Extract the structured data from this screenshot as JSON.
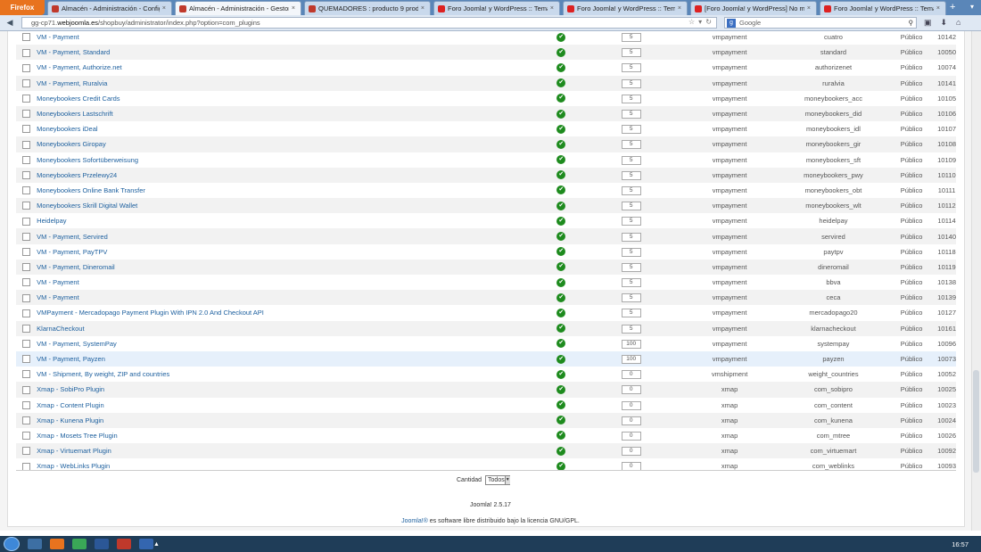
{
  "browser": {
    "app_button": "Firefox",
    "tabs": [
      {
        "label": "Almacén - Administración - Config...",
        "icon": "joomla-icon",
        "active": false
      },
      {
        "label": "Almacén - Administración - Gestor...",
        "icon": "joomla-icon",
        "active": true
      },
      {
        "label": "QUEMADORES : producto 9 produc...",
        "icon": "joomla-icon",
        "active": false
      },
      {
        "label": "Foro Joomla! y WordPress :: Tema:...",
        "icon": "wordpress-icon",
        "active": false
      },
      {
        "label": "Foro Joomla! y WordPress :: Tema:...",
        "icon": "wordpress-icon",
        "active": false
      },
      {
        "label": "[Foro Joomla! y WordPress] No me ...",
        "icon": "gmail-icon",
        "active": false
      },
      {
        "label": "Foro Joomla! y WordPress :: Tema:...",
        "icon": "wordpress-icon",
        "active": false
      }
    ],
    "url_prefix": "gg-cp71.",
    "url_domain": "webjoomla.es",
    "url_path": "/shopbuy/administrator/index.php?option=com_plugins",
    "search_placeholder": "Google"
  },
  "plugins": {
    "rows": [
      {
        "name": "VM - Payment",
        "order": "5",
        "folder": "vmpayment",
        "element": "cuatro",
        "access": "Público",
        "id": "10142"
      },
      {
        "name": "VM - Payment, Standard",
        "order": "5",
        "folder": "vmpayment",
        "element": "standard",
        "access": "Público",
        "id": "10050"
      },
      {
        "name": "VM - Payment, Authorize.net",
        "order": "5",
        "folder": "vmpayment",
        "element": "authorizenet",
        "access": "Público",
        "id": "10074"
      },
      {
        "name": "VM - Payment, Ruralvia",
        "order": "5",
        "folder": "vmpayment",
        "element": "ruralvia",
        "access": "Público",
        "id": "10141"
      },
      {
        "name": "Moneybookers Credit Cards",
        "order": "5",
        "folder": "vmpayment",
        "element": "moneybookers_acc",
        "access": "Público",
        "id": "10105"
      },
      {
        "name": "Moneybookers Lastschrift",
        "order": "5",
        "folder": "vmpayment",
        "element": "moneybookers_did",
        "access": "Público",
        "id": "10106"
      },
      {
        "name": "Moneybookers iDeal",
        "order": "5",
        "folder": "vmpayment",
        "element": "moneybookers_idl",
        "access": "Público",
        "id": "10107"
      },
      {
        "name": "Moneybookers Giropay",
        "order": "5",
        "folder": "vmpayment",
        "element": "moneybookers_gir",
        "access": "Público",
        "id": "10108"
      },
      {
        "name": "Moneybookers Sofortüberweisung",
        "order": "5",
        "folder": "vmpayment",
        "element": "moneybookers_sft",
        "access": "Público",
        "id": "10109"
      },
      {
        "name": "Moneybookers Przelewy24",
        "order": "5",
        "folder": "vmpayment",
        "element": "moneybookers_pwy",
        "access": "Público",
        "id": "10110"
      },
      {
        "name": "Moneybookers Online Bank Transfer",
        "order": "5",
        "folder": "vmpayment",
        "element": "moneybookers_obt",
        "access": "Público",
        "id": "10111"
      },
      {
        "name": "Moneybookers Skrill Digital Wallet",
        "order": "5",
        "folder": "vmpayment",
        "element": "moneybookers_wlt",
        "access": "Público",
        "id": "10112"
      },
      {
        "name": "Heidelpay",
        "order": "5",
        "folder": "vmpayment",
        "element": "heidelpay",
        "access": "Público",
        "id": "10114"
      },
      {
        "name": "VM - Payment, Servired",
        "order": "5",
        "folder": "vmpayment",
        "element": "servired",
        "access": "Público",
        "id": "10140"
      },
      {
        "name": "VM - Payment, PayTPV",
        "order": "5",
        "folder": "vmpayment",
        "element": "paytpv",
        "access": "Público",
        "id": "10118"
      },
      {
        "name": "VM - Payment, Dineromail",
        "order": "5",
        "folder": "vmpayment",
        "element": "dineromail",
        "access": "Público",
        "id": "10119"
      },
      {
        "name": "VM - Payment",
        "order": "5",
        "folder": "vmpayment",
        "element": "bbva",
        "access": "Público",
        "id": "10138"
      },
      {
        "name": "VM - Payment",
        "order": "5",
        "folder": "vmpayment",
        "element": "ceca",
        "access": "Público",
        "id": "10139"
      },
      {
        "name": "VMPayment - Mercadopago Payment Plugin With IPN 2.0 And Checkout API",
        "order": "5",
        "folder": "vmpayment",
        "element": "mercadopago20",
        "access": "Público",
        "id": "10127"
      },
      {
        "name": "KlarnaCheckout",
        "order": "5",
        "folder": "vmpayment",
        "element": "klarnacheckout",
        "access": "Público",
        "id": "10161"
      },
      {
        "name": "VM - Payment, SystemPay",
        "order": "100",
        "folder": "vmpayment",
        "element": "systempay",
        "access": "Público",
        "id": "10096"
      },
      {
        "name": "VM - Payment, Payzen",
        "order": "100",
        "folder": "vmpayment",
        "element": "payzen",
        "access": "Público",
        "id": "10073"
      },
      {
        "name": "VM - Shipment, By weight, ZIP and countries",
        "order": "0",
        "folder": "vmshipment",
        "element": "weight_countries",
        "access": "Público",
        "id": "10052"
      },
      {
        "name": "Xmap - SobiPro Plugin",
        "order": "0",
        "folder": "xmap",
        "element": "com_sobipro",
        "access": "Público",
        "id": "10025"
      },
      {
        "name": "Xmap - Content Plugin",
        "order": "0",
        "folder": "xmap",
        "element": "com_content",
        "access": "Público",
        "id": "10023"
      },
      {
        "name": "Xmap - Kunena Plugin",
        "order": "0",
        "folder": "xmap",
        "element": "com_kunena",
        "access": "Público",
        "id": "10024"
      },
      {
        "name": "Xmap - Mosets Tree Plugin",
        "order": "0",
        "folder": "xmap",
        "element": "com_mtree",
        "access": "Público",
        "id": "10026"
      },
      {
        "name": "Xmap - Virtuemart Plugin",
        "order": "0",
        "folder": "xmap",
        "element": "com_virtuemart",
        "access": "Público",
        "id": "10092"
      },
      {
        "name": "Xmap - WebLinks Plugin",
        "order": "0",
        "folder": "xmap",
        "element": "com_weblinks",
        "access": "Público",
        "id": "10093"
      }
    ],
    "highlighted_row": 21
  },
  "pagination": {
    "label": "Cantidad",
    "selected": "Todos"
  },
  "footer": {
    "version": "Joomla! 2.5.17",
    "license_link": "Joomla!®",
    "license_text": " es software libre distribuido bajo la licencia GNU/GPL."
  },
  "taskbar": {
    "clock": "16:57"
  },
  "colors": {
    "link": "#1c5f9e",
    "status_ok": "#1e8b1e",
    "tabbar": "#5a86b8",
    "taskbar": "#1f3d58"
  }
}
